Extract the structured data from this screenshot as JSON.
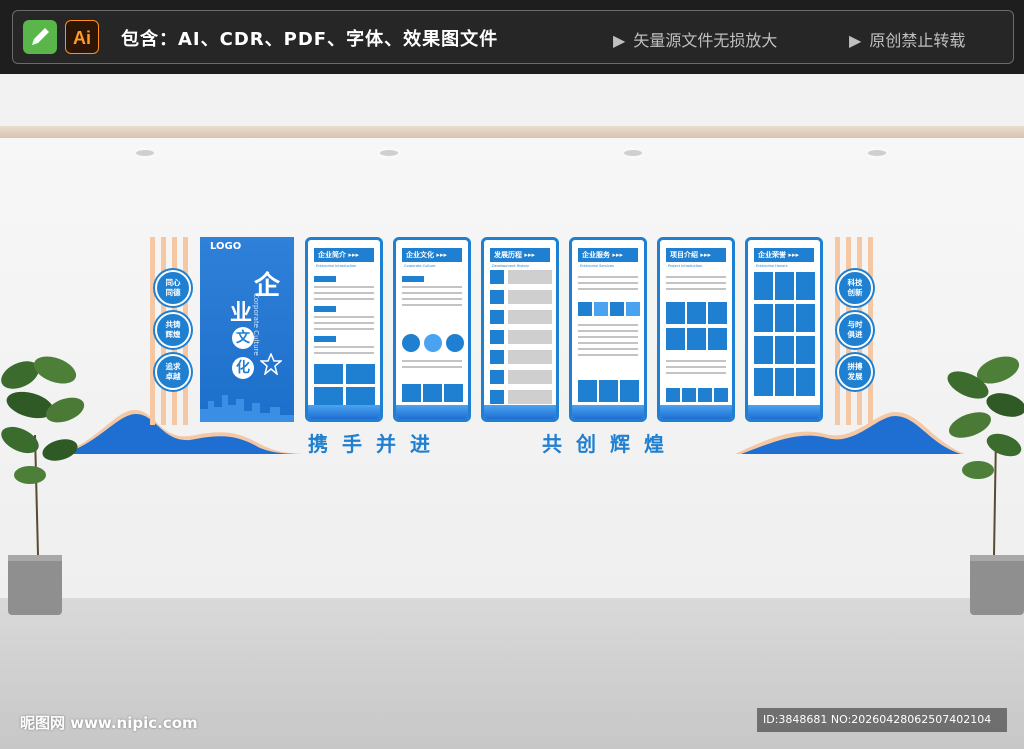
{
  "banner": {
    "ai_icon_text": "Ai",
    "contains_text": "包含：AI、CDR、PDF、字体、效果图文件",
    "note1": "矢量源文件无损放大",
    "note2": "原创禁止转载",
    "triangle": "▶"
  },
  "display": {
    "logo": "LOGO",
    "char_qi": "企",
    "char_ye": "业",
    "char_wen": "文",
    "char_hua": "化",
    "corporate": "Corporate Culture",
    "left_circles": [
      "同心\n同德",
      "共铸\n辉煌",
      "追求\n卓越"
    ],
    "right_circles": [
      "科技\n创新",
      "与时\n俱进",
      "拼搏\n发展"
    ],
    "panels": [
      {
        "title": "企业简介 ▸▸▸",
        "tag": "Enterprise Introduction"
      },
      {
        "title": "企业文化 ▸▸▸",
        "tag": "Corporate Culture"
      },
      {
        "title": "发展历程 ▸▸▸",
        "tag": "Development History"
      },
      {
        "title": "企业服务 ▸▸▸",
        "tag": "Enterprise Services"
      },
      {
        "title": "项目介绍 ▸▸▸",
        "tag": "Project Introduction"
      },
      {
        "title": "企业荣誉 ▸▸▸",
        "tag": "Enterprise Honors"
      }
    ],
    "slogan_left": "携手并进",
    "slogan_right": "共创辉煌"
  },
  "watermark": {
    "site": "昵图网 www.nipic.com",
    "id_text": "ID:3848681 NO:20260428062507402104"
  },
  "colors": {
    "accent": "#1f7fd0",
    "stripe": "#f5c7a3"
  }
}
